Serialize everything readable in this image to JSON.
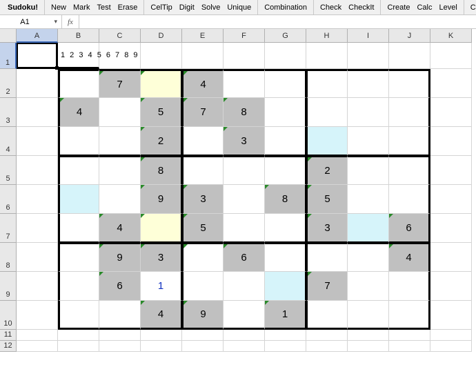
{
  "toolbar": {
    "app": "Sudoku!",
    "grp1": [
      "New",
      "Mark",
      "Test",
      "Erase"
    ],
    "grp2": [
      "CelTip",
      "Digit",
      "Solve",
      "Unique"
    ],
    "grp3": [
      "Combination"
    ],
    "grp4": [
      "Check",
      "CheckIt"
    ],
    "grp5": [
      "Create",
      "Calc",
      "Level"
    ],
    "grp6": [
      "Cleanup"
    ]
  },
  "refbar": {
    "name": "A1",
    "fx": "fx",
    "formula": ""
  },
  "columns": [
    "A",
    "B",
    "C",
    "D",
    "E",
    "F",
    "G",
    "H",
    "I",
    "J",
    "K"
  ],
  "rows": [
    "1",
    "2",
    "3",
    "4",
    "5",
    "6",
    "7",
    "8",
    "9",
    "10",
    "11",
    "12"
  ],
  "candidates": "1 2 3 4 5 6 7 8 9",
  "selected_col": "A",
  "selected_row": "1",
  "sudoku": [
    [
      {
        "v": "",
        "f": ""
      },
      {
        "v": "7",
        "f": "g",
        "m": 1
      },
      {
        "v": "",
        "f": "y",
        "m": 1
      },
      {
        "v": "4",
        "f": "g",
        "m": 1
      },
      {
        "v": "",
        "f": ""
      },
      {
        "v": "",
        "f": ""
      },
      {
        "v": "",
        "f": ""
      },
      {
        "v": "",
        "f": ""
      },
      {
        "v": "",
        "f": ""
      }
    ],
    [
      {
        "v": "4",
        "f": "g",
        "m": 1
      },
      {
        "v": "",
        "f": ""
      },
      {
        "v": "5",
        "f": "g",
        "m": 1
      },
      {
        "v": "7",
        "f": "g",
        "m": 1
      },
      {
        "v": "8",
        "f": "g",
        "m": 1
      },
      {
        "v": "",
        "f": ""
      },
      {
        "v": "",
        "f": ""
      },
      {
        "v": "",
        "f": ""
      },
      {
        "v": "",
        "f": ""
      }
    ],
    [
      {
        "v": "",
        "f": ""
      },
      {
        "v": "",
        "f": ""
      },
      {
        "v": "2",
        "f": "g",
        "m": 1
      },
      {
        "v": "",
        "f": ""
      },
      {
        "v": "3",
        "f": "g",
        "m": 1
      },
      {
        "v": "",
        "f": ""
      },
      {
        "v": "",
        "f": "c"
      },
      {
        "v": "",
        "f": ""
      },
      {
        "v": "",
        "f": ""
      }
    ],
    [
      {
        "v": "",
        "f": ""
      },
      {
        "v": "",
        "f": ""
      },
      {
        "v": "8",
        "f": "g",
        "m": 1
      },
      {
        "v": "",
        "f": ""
      },
      {
        "v": "",
        "f": ""
      },
      {
        "v": "",
        "f": ""
      },
      {
        "v": "2",
        "f": "g",
        "m": 1
      },
      {
        "v": "",
        "f": ""
      },
      {
        "v": "",
        "f": ""
      }
    ],
    [
      {
        "v": "",
        "f": "c"
      },
      {
        "v": "",
        "f": ""
      },
      {
        "v": "9",
        "f": "g",
        "m": 1
      },
      {
        "v": "3",
        "f": "g",
        "m": 1
      },
      {
        "v": "",
        "f": ""
      },
      {
        "v": "8",
        "f": "g",
        "m": 1
      },
      {
        "v": "5",
        "f": "g",
        "m": 1
      },
      {
        "v": "",
        "f": ""
      },
      {
        "v": "",
        "f": ""
      }
    ],
    [
      {
        "v": "",
        "f": ""
      },
      {
        "v": "4",
        "f": "g",
        "m": 1
      },
      {
        "v": "",
        "f": "y",
        "m": 1
      },
      {
        "v": "5",
        "f": "g",
        "m": 1
      },
      {
        "v": "",
        "f": ""
      },
      {
        "v": "",
        "f": ""
      },
      {
        "v": "3",
        "f": "g",
        "m": 1
      },
      {
        "v": "",
        "f": "c"
      },
      {
        "v": "6",
        "f": "g",
        "m": 1
      }
    ],
    [
      {
        "v": "",
        "f": ""
      },
      {
        "v": "9",
        "f": "g",
        "m": 1
      },
      {
        "v": "3",
        "f": "g",
        "m": 1
      },
      {
        "v": "",
        "f": "",
        "m": 1
      },
      {
        "v": "6",
        "f": "g",
        "m": 1
      },
      {
        "v": "",
        "f": ""
      },
      {
        "v": "",
        "f": ""
      },
      {
        "v": "",
        "f": ""
      },
      {
        "v": "4",
        "f": "g",
        "m": 1
      }
    ],
    [
      {
        "v": "",
        "f": ""
      },
      {
        "v": "6",
        "f": "g",
        "m": 1
      },
      {
        "v": "1",
        "f": "",
        "blue": 1
      },
      {
        "v": "",
        "f": ""
      },
      {
        "v": "",
        "f": ""
      },
      {
        "v": "",
        "f": "c"
      },
      {
        "v": "7",
        "f": "g",
        "m": 1
      },
      {
        "v": "",
        "f": ""
      },
      {
        "v": "",
        "f": ""
      }
    ],
    [
      {
        "v": "",
        "f": ""
      },
      {
        "v": "",
        "f": ""
      },
      {
        "v": "4",
        "f": "g",
        "m": 1
      },
      {
        "v": "9",
        "f": "g",
        "m": 1
      },
      {
        "v": "",
        "f": ""
      },
      {
        "v": "1",
        "f": "g",
        "m": 1
      },
      {
        "v": "",
        "f": ""
      },
      {
        "v": "",
        "f": ""
      },
      {
        "v": "",
        "f": ""
      }
    ]
  ]
}
